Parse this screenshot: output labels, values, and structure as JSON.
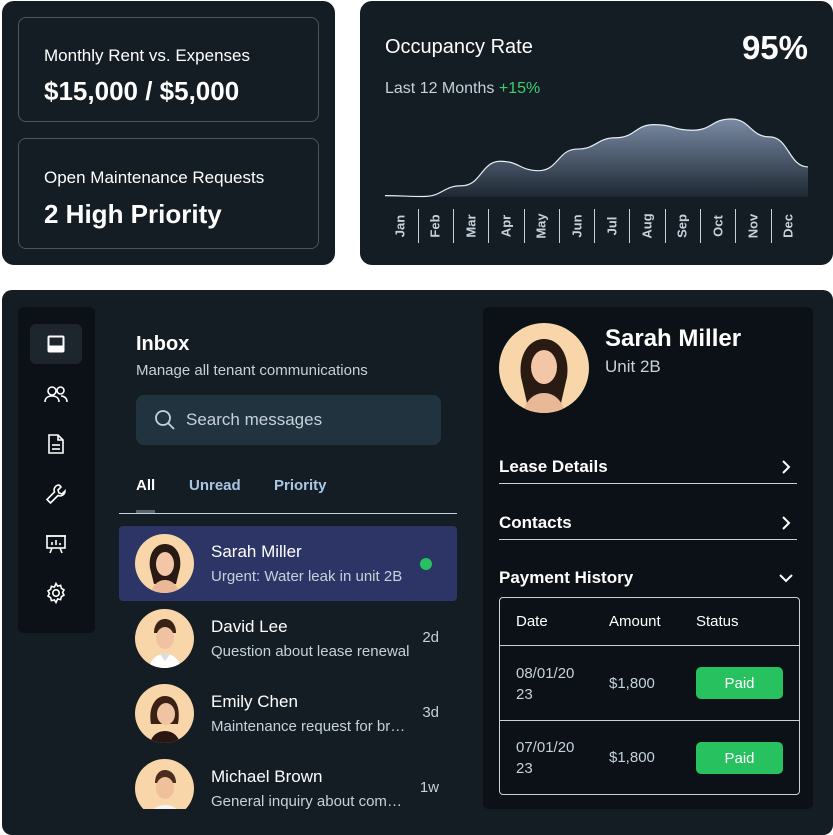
{
  "stats": {
    "rent_label": "Monthly Rent vs. Expenses",
    "rent_value": "$15,000 / $5,000",
    "maint_label": "Open Maintenance Requests",
    "maint_value": "2 High Priority"
  },
  "occupancy": {
    "title": "Occupancy Rate",
    "value": "95%",
    "period": "Last 12 Months",
    "change": "+15%",
    "months": [
      "Jan",
      "Feb",
      "Mar",
      "Apr",
      "May",
      "Jun",
      "Jul",
      "Aug",
      "Sep",
      "Oct",
      "Nov",
      "Dec"
    ]
  },
  "chart_data": {
    "type": "area",
    "title": "Occupancy Rate",
    "categories": [
      "Jan",
      "Feb",
      "Mar",
      "Apr",
      "May",
      "Jun",
      "Jul",
      "Aug",
      "Sep",
      "Oct",
      "Nov",
      "Dec"
    ],
    "series": [
      {
        "values": [
          1.5,
          0.5,
          12,
          38,
          28,
          51,
          63,
          77,
          71,
          83,
          64,
          32
        ]
      }
    ],
    "ylim": [
      0,
      100
    ],
    "grid": false
  },
  "sidebar": {
    "icons": [
      "inbox-icon",
      "users-icon",
      "document-icon",
      "wrench-icon",
      "presentation-icon",
      "gear-icon"
    ]
  },
  "inbox": {
    "title": "Inbox",
    "subtitle": "Manage all tenant communications",
    "search_placeholder": "Search  messages",
    "tabs": [
      "All",
      "Unread",
      "Priority"
    ],
    "messages": [
      {
        "name": "Sarah Miller",
        "preview": "Urgent: Water leak in unit 2B",
        "time": ""
      },
      {
        "name": "David Lee",
        "preview": "Question about lease renewal",
        "time": "2d"
      },
      {
        "name": "Emily Chen",
        "preview": "Maintenance request for bro...",
        "time": "3d"
      },
      {
        "name": "Michael Brown",
        "preview": "General inquiry about comm...",
        "time": "1w"
      }
    ]
  },
  "tenant": {
    "name": "Sarah Miller",
    "unit": "Unit 2B",
    "sections": [
      "Lease Details",
      "Contacts",
      "Payment History"
    ],
    "payments": {
      "headers": [
        "Date",
        "Amount",
        "Status"
      ],
      "rows": [
        {
          "date": "08/01/2023",
          "amount": "$1,800",
          "status": "Paid"
        },
        {
          "date": "07/01/2023",
          "amount": "$1,800",
          "status": "Paid"
        }
      ]
    }
  },
  "colors": {
    "card_bg": "#141c24",
    "panel_bg": "#0b1116",
    "accent_green": "#27c25f",
    "active_row": "#2c3566",
    "search_bg": "#223340",
    "chart_fill_top": "#7a8ba4"
  }
}
